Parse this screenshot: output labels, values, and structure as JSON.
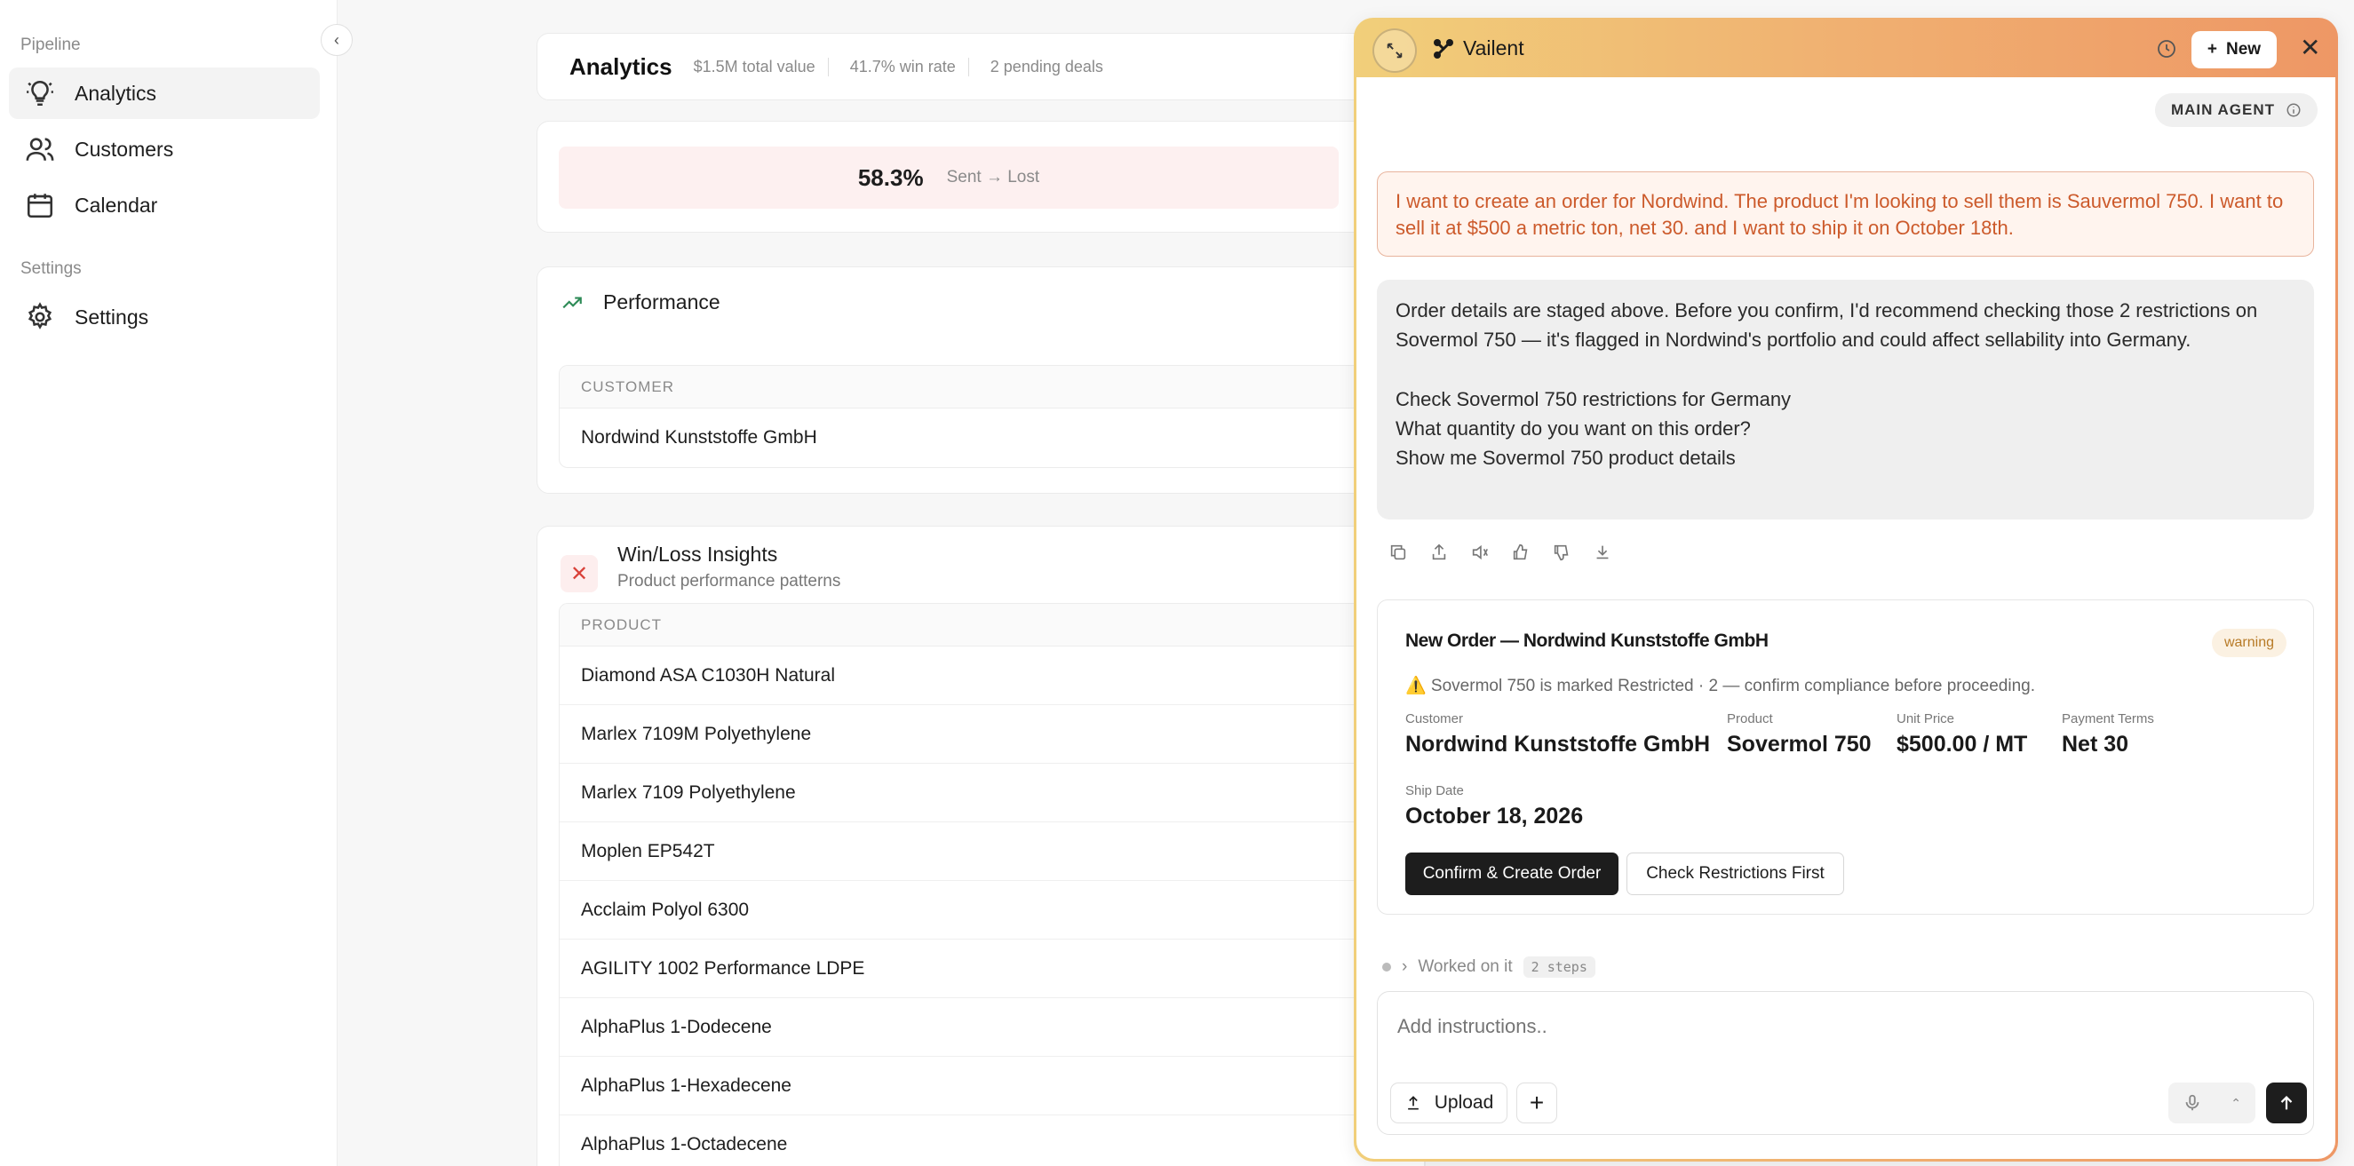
{
  "sidebar": {
    "section_pipeline": "Pipeline",
    "items": [
      {
        "label": "Analytics",
        "icon": "lightbulb-icon"
      },
      {
        "label": "Customers",
        "icon": "users-icon"
      },
      {
        "label": "Calendar",
        "icon": "calendar-icon"
      }
    ],
    "section_settings": "Settings",
    "settings_item": {
      "label": "Settings",
      "icon": "gear-icon"
    }
  },
  "analytics": {
    "title": "Analytics",
    "stats": [
      "$1.5M total value",
      "41.7% win rate",
      "2 pending deals"
    ]
  },
  "rate": {
    "value": "58.3%",
    "label": "Sent → Lost"
  },
  "performance": {
    "title": "Performance",
    "column": "CUSTOMER",
    "rows": [
      "Nordwind Kunststoffe GmbH"
    ]
  },
  "winloss": {
    "title": "Win/Loss Insights",
    "subtitle": "Product performance patterns",
    "column": "PRODUCT",
    "rows": [
      "Diamond ASA C1030H Natural",
      "Marlex 7109M Polyethylene",
      "Marlex 7109 Polyethylene",
      "Moplen EP542T",
      "Acclaim Polyol 6300",
      "AGILITY 1002 Performance LDPE",
      "AlphaPlus 1-Dodecene",
      "AlphaPlus 1-Hexadecene",
      "AlphaPlus 1-Octadecene"
    ]
  },
  "agent": {
    "brand": "Vailent",
    "new_label": "New",
    "badge": "MAIN AGENT",
    "user_message": "I want to create an order for Nordwind. The product I'm looking to sell them is Sauvermol 750. I want to sell it at $500 a metric ton, net 30. and I want to ship it on October 18th.",
    "assistant_intro": "Order details are staged above. Before you confirm, I'd recommend checking those 2 restrictions on Sovermol 750 — it's flagged in Nordwind's portfolio and could affect sellability into Germany.",
    "suggestions": [
      "Check Sovermol 750 restrictions for Germany",
      "What quantity do you want on this order?",
      "Show me Sovermol 750 product details"
    ],
    "order": {
      "title": "New Order — Nordwind Kunststoffe GmbH",
      "badge": "warning",
      "warning": "⚠️ Sovermol 750 is marked Restricted · 2 — confirm compliance before proceeding.",
      "customer_label": "Customer",
      "customer": "Nordwind Kunststoffe GmbH",
      "product_label": "Product",
      "product": "Sovermol 750",
      "price_label": "Unit Price",
      "price": "$500.00 / MT",
      "terms_label": "Payment Terms",
      "terms": "Net 30",
      "ship_label": "Ship Date",
      "ship_date": "October 18, 2026",
      "confirm_label": "Confirm & Create Order",
      "check_label": "Check Restrictions First"
    },
    "worked": "Worked on it",
    "steps": "2 steps",
    "composer": {
      "placeholder": "Add instructions..",
      "upload_label": "Upload"
    }
  },
  "colors": {
    "accent_gradient_start": "#f1cf7a",
    "accent_gradient_end": "#ee9765",
    "user_msg_text": "#cc5a2b",
    "warning_badge": "#b77a26",
    "negative_icon": "#d9423a",
    "trend_icon": "#2e8b57"
  }
}
